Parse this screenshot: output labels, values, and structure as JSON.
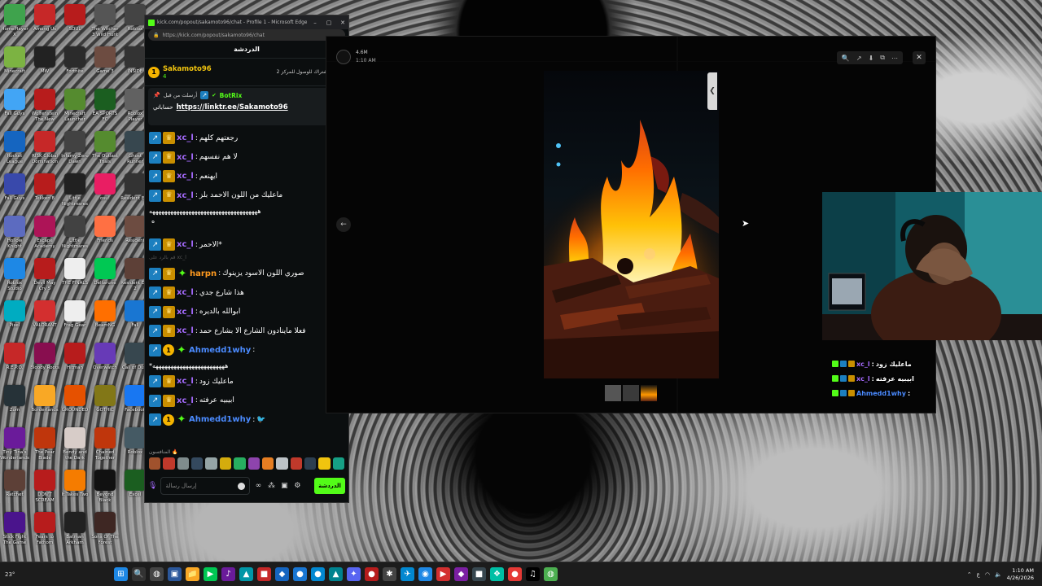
{
  "desktop": {
    "icons": [
      {
        "label": "HomePlayer X",
        "color": "#3fa34d"
      },
      {
        "label": "Among Us",
        "color": "#c62828"
      },
      {
        "label": "SOUL",
        "color": "#b71c1c"
      },
      {
        "label": "The Witcher 3 Wild Hunt",
        "color": "#555555"
      },
      {
        "label": "Roblox",
        "color": "#444444"
      },
      {
        "label": "Minecraft",
        "color": "#7cb342"
      },
      {
        "label": "MW",
        "color": "#222222"
      },
      {
        "label": "Fortnite",
        "color": "#2b2b2b"
      },
      {
        "label": "Game 3",
        "color": "#6d4c41"
      },
      {
        "label": "INSIDE",
        "color": "#333333"
      },
      {
        "label": "Fall Guys",
        "color": "#42a5f5"
      },
      {
        "label": "Wolfenstein The New Order",
        "color": "#b71c1c"
      },
      {
        "label": "Minecraft Launcher",
        "color": "#558b2f"
      },
      {
        "label": "EA SPORTS FC",
        "color": "#1b5e20"
      },
      {
        "label": "Roblox Player",
        "color": "#616161"
      },
      {
        "label": "Rocket League",
        "color": "#1565c0"
      },
      {
        "label": "RISK Global Domination",
        "color": "#c62828"
      },
      {
        "label": "Infamy Zero Dawn",
        "color": "#424242"
      },
      {
        "label": "The Outlast Trials",
        "color": "#558b2f"
      },
      {
        "label": "Ghost Runner",
        "color": "#37474f"
      },
      {
        "label": "Fall Guys",
        "color": "#3949ab"
      },
      {
        "label": "Tekken 8",
        "color": "#b71c1c"
      },
      {
        "label": "Little Nightmares",
        "color": "#212121"
      },
      {
        "label": "osu!",
        "color": "#e91e63"
      },
      {
        "label": "Resident Evil",
        "color": "#333333"
      },
      {
        "label": "Hollow Knight",
        "color": "#5c6bc0"
      },
      {
        "label": "Escape Academy",
        "color": "#ad1457"
      },
      {
        "label": "Little Nightmares II",
        "color": "#424242"
      },
      {
        "label": "Friends",
        "color": "#ff7043"
      },
      {
        "label": "Resident",
        "color": "#6d4c41"
      },
      {
        "label": "Roblox Studio",
        "color": "#1e88e5"
      },
      {
        "label": "Devil May Cry 5",
        "color": "#b71c1c"
      },
      {
        "label": "THE FINALS",
        "color": "#eeeeee"
      },
      {
        "label": "Deltarune",
        "color": "#00c853"
      },
      {
        "label": "Resident Evil 2",
        "color": "#5d4037"
      },
      {
        "label": "Pixel",
        "color": "#00acc1"
      },
      {
        "label": "VALORANT",
        "color": "#d32f2f"
      },
      {
        "label": "Frag Gear",
        "color": "#eeeeee"
      },
      {
        "label": "BeamNG",
        "color": "#ff6f00"
      },
      {
        "label": "Fall",
        "color": "#1976d2"
      },
      {
        "label": "R.E.P.O.",
        "color": "#c62828"
      },
      {
        "label": "Bloody Roots",
        "color": "#880e4f"
      },
      {
        "label": "Hitman",
        "color": "#b71c1c"
      },
      {
        "label": "Overwatch",
        "color": "#673ab7"
      },
      {
        "label": "Call of Duty",
        "color": "#37474f"
      },
      {
        "label": "Zom",
        "color": "#263238"
      },
      {
        "label": "Borderlands",
        "color": "#f9a825"
      },
      {
        "label": "GROUNDED",
        "color": "#e65100"
      },
      {
        "label": "GOTHIC",
        "color": "#827717"
      },
      {
        "label": "Facebook",
        "color": "#1877f2"
      },
      {
        "label": "Tiny Tina's Wonderlands",
        "color": "#6a1b9a"
      },
      {
        "label": "The Pear Blade",
        "color": "#bf360c"
      },
      {
        "label": "Bendy and the Dark Revival",
        "color": "#d7ccc8"
      },
      {
        "label": "Chained Together",
        "color": "#bf360c"
      },
      {
        "label": "Roblox",
        "color": "#455a64"
      },
      {
        "label": "Ratchet",
        "color": "#5d4037"
      },
      {
        "label": "DON'T SCREAM",
        "color": "#b71c1c"
      },
      {
        "label": "It Takes Two",
        "color": "#f57c00"
      },
      {
        "label": "Beyond Black",
        "color": "#111111"
      },
      {
        "label": "Excel",
        "color": "#1b5e20"
      },
      {
        "label": "Stick Fight The Game",
        "color": "#4a148c"
      },
      {
        "label": "Fears to Fathom",
        "color": "#b71c1c"
      },
      {
        "label": "Batman Arkham Asylum",
        "color": "#212121"
      },
      {
        "label": "Sons Of The Forest",
        "color": "#3e2723"
      }
    ]
  },
  "browser": {
    "title": "kick.com/popout/sakamoto96/chat - Profile 1 - Microsoft Edge",
    "url": "https://kick.com/popout/sakamoto96/chat",
    "chat_header": "الدردشة",
    "top_gifter": {
      "rank": "1",
      "name": "Sakamoto96",
      "count": "4",
      "note": "إهداء 1 اشتراك للوصول للمركز 2"
    },
    "pinned": {
      "sent_by": "أرسلت من قبل",
      "bot_name": "BotRix",
      "account_label": "حساباتي",
      "link": "https://linktr.ee/Sakamoto96"
    },
    "messages": [
      {
        "user": "xc_l",
        "color": "purple",
        "badges": [
          "sub",
          "crown"
        ],
        "text": "رجعتهم كلهم"
      },
      {
        "user": "xc_l",
        "color": "purple",
        "badges": [
          "sub",
          "crown"
        ],
        "text": "لا هم نفسهم"
      },
      {
        "user": "xc_l",
        "color": "purple",
        "badges": [
          "sub",
          "crown"
        ],
        "text": "ايهنعم"
      },
      {
        "user": "xc_l",
        "color": "purple",
        "badges": [
          "sub",
          "crown"
        ],
        "text": "ماعليك من اللون الاحمد بلز"
      }
    ],
    "long_line_1": "ههههههههههههههههههههههههههههههههههههه",
    "short_line": "ه",
    "messages_2": [
      {
        "user": "xc_l",
        "color": "purple",
        "badges": [
          "sub",
          "crown"
        ],
        "text": "الاحمر*"
      }
    ],
    "ghost_line": "قم بالرد على xc_l",
    "messages_3": [
      {
        "user": "harpn",
        "color": "orange",
        "badges": [
          "sub",
          "crown",
          "star"
        ],
        "text": "صوري اللون الاسود يزينوك"
      },
      {
        "user": "xc_l",
        "color": "purple",
        "badges": [
          "sub",
          "crown"
        ],
        "text": "هذا شارع جدي"
      },
      {
        "user": "xc_l",
        "color": "purple",
        "badges": [
          "sub",
          "crown"
        ],
        "text": "ابوالله بالديره"
      },
      {
        "user": "xc_l",
        "color": "purple",
        "badges": [
          "sub",
          "crown"
        ],
        "text": "فعلا ماينادون الشارع الا بشارع حمد"
      },
      {
        "user": "Ahmedd1why",
        "color": "blue",
        "badges": [
          "sub",
          "gift",
          "star"
        ],
        "text": ""
      }
    ],
    "long_line_2": "*ههههههههههههههههههههههههه",
    "messages_4": [
      {
        "user": "xc_l",
        "color": "purple",
        "badges": [
          "sub",
          "crown"
        ],
        "text": "ماعليك زود"
      },
      {
        "user": "xc_l",
        "color": "purple",
        "badges": [
          "sub",
          "crown"
        ],
        "text": "ابيبيه عرفته"
      },
      {
        "user": "Ahmedd1why",
        "color": "blue",
        "badges": [
          "sub",
          "gift",
          "star"
        ],
        "text": "🐦"
      }
    ],
    "emotes_label": "المنافسون 🔥",
    "emote_colors": [
      "#a0522d",
      "#c0392b",
      "#7f8c8d",
      "#34495e",
      "#95a5a6",
      "#d4ac0d",
      "#27ae60",
      "#8e44ad",
      "#e67e22",
      "#bdc3c7",
      "#c0392b",
      "#2c3e50",
      "#f1c40f",
      "#16a085"
    ],
    "input_placeholder": "إرسال رسالة",
    "send_label": "الدردشة"
  },
  "viewer": {
    "sender_name": "4.6M",
    "sender_time": "1:10 AM",
    "tools": [
      "🔍",
      "↗",
      "⬇",
      "⧉",
      "⋯"
    ],
    "close": "✕",
    "nav_prev": "←",
    "side_tab": "❮"
  },
  "overlay": {
    "lines": [
      {
        "user": "xc_l",
        "text": "ماعليك زود",
        "color": "#a66bff"
      },
      {
        "user": "xc_l",
        "text": "ابيبيه عرفته",
        "color": "#a66bff"
      },
      {
        "user": "Ahmedd1why",
        "text": "",
        "color": "#4b8bff"
      }
    ]
  },
  "taskbar": {
    "weather": "23°",
    "time": "1:10 AM",
    "date": "4/26/2026",
    "lang": "ع",
    "icons": [
      {
        "glyph": "⊞",
        "color": "#1e88e5"
      },
      {
        "glyph": "🔍",
        "color": "#333333"
      },
      {
        "glyph": "◍",
        "color": "#444444"
      },
      {
        "glyph": "▣",
        "color": "#2b579a"
      },
      {
        "glyph": "📁",
        "color": "#f9a825"
      },
      {
        "glyph": "▶",
        "color": "#00c853"
      },
      {
        "glyph": "♪",
        "color": "#6a1b9a"
      },
      {
        "glyph": "▲",
        "color": "#0097a7"
      },
      {
        "glyph": "■",
        "color": "#c62828"
      },
      {
        "glyph": "◆",
        "color": "#1565c0"
      },
      {
        "glyph": "●",
        "color": "#1976d2"
      },
      {
        "glyph": "●",
        "color": "#0288d1"
      },
      {
        "glyph": "▲",
        "color": "#00838f"
      },
      {
        "glyph": "✦",
        "color": "#5865f2"
      },
      {
        "glyph": "●",
        "color": "#b71c1c"
      },
      {
        "glyph": "✱",
        "color": "#444444"
      },
      {
        "glyph": "✈",
        "color": "#0288d1"
      },
      {
        "glyph": "◉",
        "color": "#1e88e5"
      },
      {
        "glyph": "▶",
        "color": "#d32f2f"
      },
      {
        "glyph": "◆",
        "color": "#7b1fa2"
      },
      {
        "glyph": "■",
        "color": "#37474f"
      },
      {
        "glyph": "❖",
        "color": "#00bfa5"
      },
      {
        "glyph": "●",
        "color": "#e53935"
      },
      {
        "glyph": "♫",
        "color": "#000000"
      },
      {
        "glyph": "◍",
        "color": "#4caf50"
      }
    ]
  }
}
